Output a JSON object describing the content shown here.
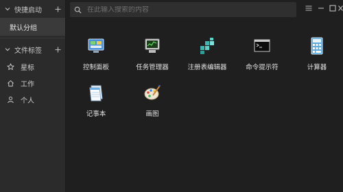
{
  "sidebar": {
    "quick_launch_title": "快捷启动",
    "default_group": "默认分组",
    "file_tags_title": "文件标签",
    "tags": [
      {
        "label": "星标",
        "icon": "star-icon"
      },
      {
        "label": "工作",
        "icon": "home-icon"
      },
      {
        "label": "个人",
        "icon": "person-icon"
      }
    ]
  },
  "search": {
    "placeholder": "在此输入搜索的内容"
  },
  "apps": [
    {
      "label": "控制面板",
      "icon": "control-panel-icon"
    },
    {
      "label": "任务管理器",
      "icon": "task-manager-icon"
    },
    {
      "label": "注册表编辑器",
      "icon": "registry-editor-icon"
    },
    {
      "label": "命令提示符",
      "icon": "command-prompt-icon"
    },
    {
      "label": "计算器",
      "icon": "calculator-icon"
    },
    {
      "label": "记事本",
      "icon": "notepad-icon"
    },
    {
      "label": "画图",
      "icon": "paint-icon"
    }
  ],
  "colors": {
    "sidebar_bg": "#2b2b2b",
    "main_bg": "#1f1f1f",
    "selected_bg": "#3a3a3a"
  }
}
